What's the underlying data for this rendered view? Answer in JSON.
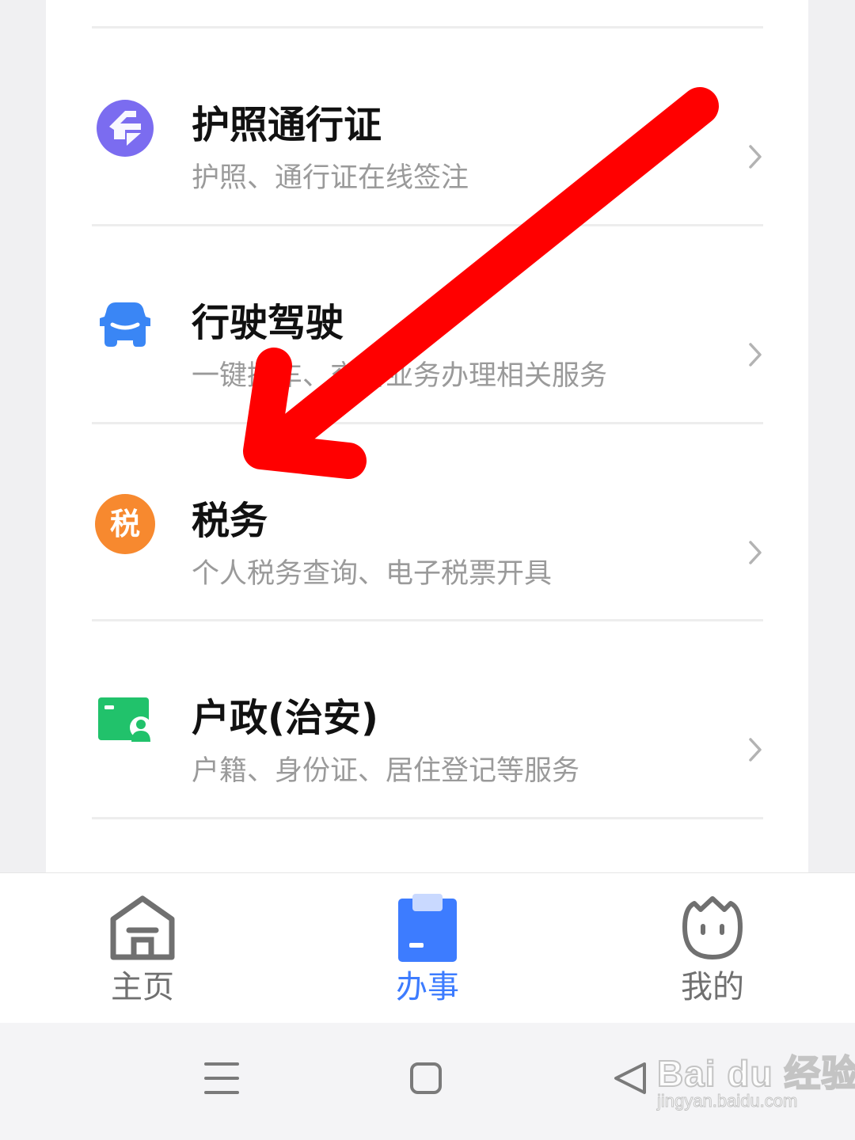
{
  "services": [
    {
      "title": "护照通行证",
      "subtitle": "护照、通行证在线签注",
      "icon": "passport-icon",
      "color": "#7b6cf0"
    },
    {
      "title": "行驶驾驶",
      "subtitle": "一键挪车、交管业务办理相关服务",
      "icon": "car-icon",
      "color": "#3a86f5"
    },
    {
      "title": "税务",
      "subtitle": "个人税务查询、电子税票开具",
      "icon": "tax-icon",
      "icon_text": "税",
      "color": "#f7892f"
    },
    {
      "title": "户政(治安)",
      "subtitle": "户籍、身份证、居住登记等服务",
      "icon": "household-id-icon",
      "color": "#21c26b"
    }
  ],
  "tabbar": {
    "tabs": [
      {
        "label": "主页",
        "icon": "home-icon",
        "active": false
      },
      {
        "label": "办事",
        "icon": "clipboard-icon",
        "active": true
      },
      {
        "label": "我的",
        "icon": "profile-icon",
        "active": false
      }
    ],
    "active_color": "#3d7cff"
  },
  "watermark": {
    "brand": "Bai du 经验",
    "url": "jingyan.baidu.com"
  },
  "annotation": {
    "type": "red-arrow",
    "color": "#ff0000",
    "target": "税务"
  }
}
